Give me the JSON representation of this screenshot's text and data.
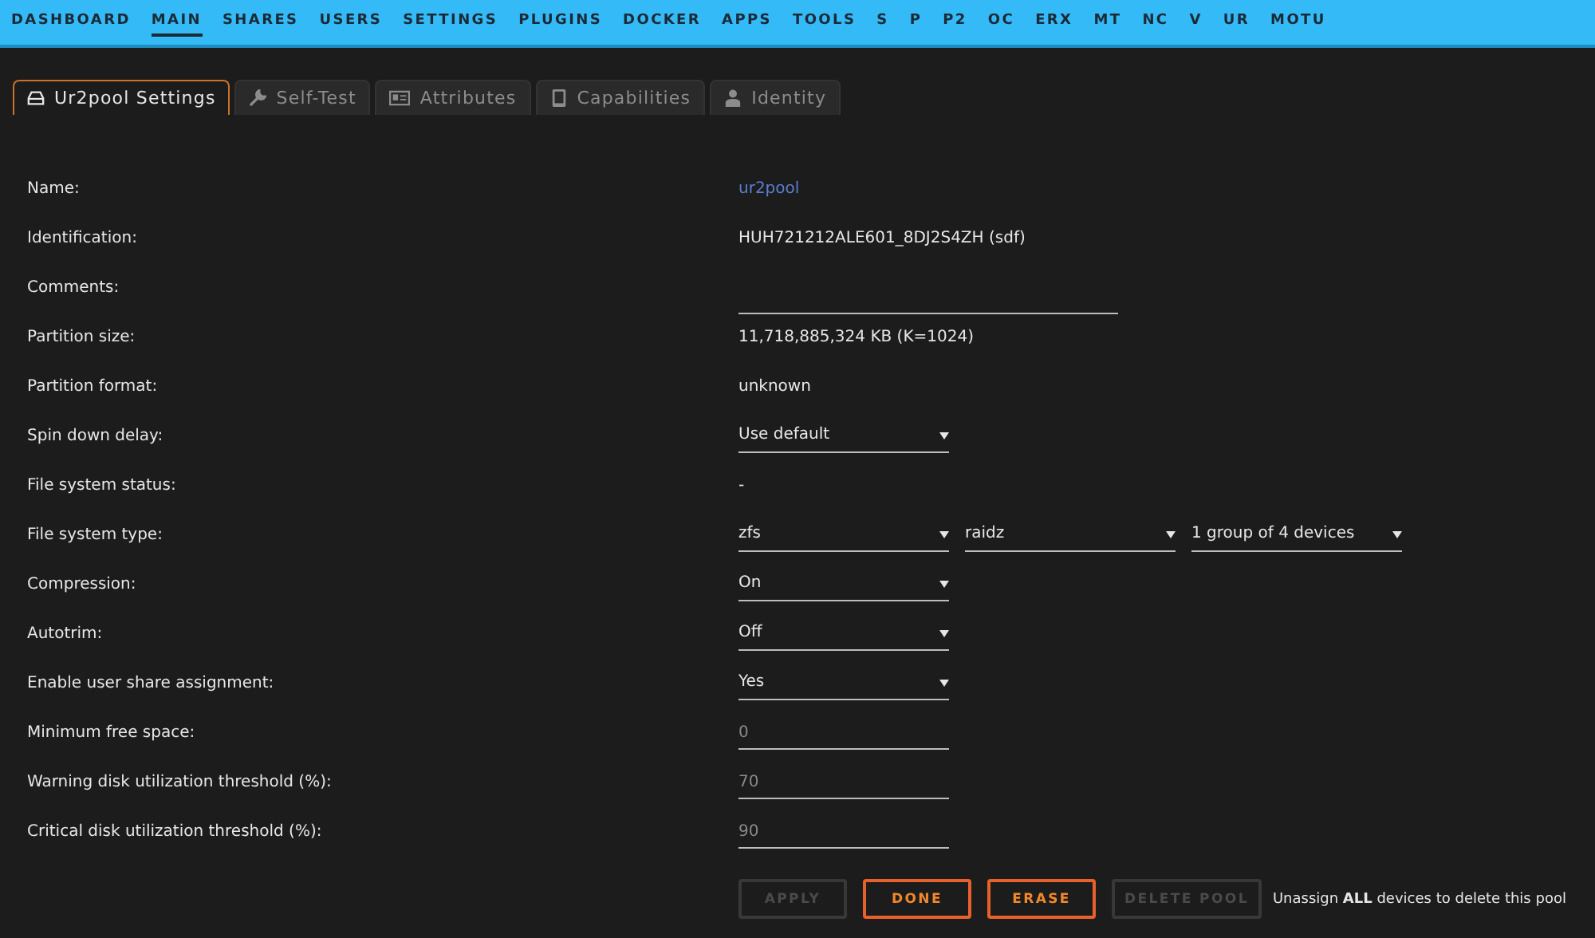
{
  "nav": [
    {
      "label": "DASHBOARD",
      "selected": false
    },
    {
      "label": "MAIN",
      "selected": true
    },
    {
      "label": "SHARES",
      "selected": false
    },
    {
      "label": "USERS",
      "selected": false
    },
    {
      "label": "SETTINGS",
      "selected": false
    },
    {
      "label": "PLUGINS",
      "selected": false
    },
    {
      "label": "DOCKER",
      "selected": false
    },
    {
      "label": "APPS",
      "selected": false
    },
    {
      "label": "TOOLS",
      "selected": false
    },
    {
      "label": "S",
      "selected": false
    },
    {
      "label": "P",
      "selected": false
    },
    {
      "label": "P2",
      "selected": false
    },
    {
      "label": "OC",
      "selected": false
    },
    {
      "label": "ERX",
      "selected": false
    },
    {
      "label": "MT",
      "selected": false
    },
    {
      "label": "NC",
      "selected": false
    },
    {
      "label": "V",
      "selected": false
    },
    {
      "label": "UR",
      "selected": false
    },
    {
      "label": "MOTU",
      "selected": false
    }
  ],
  "tabs": [
    {
      "label": "Ur2pool Settings",
      "kind": "drive",
      "selected": true
    },
    {
      "label": "Self-Test",
      "kind": "wrench",
      "selected": false
    },
    {
      "label": "Attributes",
      "kind": "card",
      "selected": false
    },
    {
      "label": "Capabilities",
      "kind": "tablet",
      "selected": false
    },
    {
      "label": "Identity",
      "kind": "user",
      "selected": false
    }
  ],
  "fields": [
    {
      "label": "Name:",
      "kind": "link",
      "value": "ur2pool"
    },
    {
      "label": "Identification:",
      "kind": "text",
      "value": "HUH721212ALE601_8DJ2S4ZH (sdf)"
    },
    {
      "label": "Comments:",
      "kind": "input"
    },
    {
      "label": "Partition size:",
      "kind": "text",
      "value": "11,718,885,324 KB (K=1024)"
    },
    {
      "label": "Partition format:",
      "kind": "text",
      "value": "unknown"
    },
    {
      "label": "Spin down delay:",
      "kind": "select",
      "options": [
        "Use default"
      ]
    },
    {
      "label": "File system status:",
      "kind": "text",
      "value": "-"
    },
    {
      "label": "File system type:",
      "kind": "select",
      "options": [
        "zfs",
        "raidz",
        "1 group of 4 devices"
      ]
    },
    {
      "label": "Compression:",
      "kind": "select",
      "options": [
        "On"
      ]
    },
    {
      "label": "Autotrim:",
      "kind": "select",
      "options": [
        "Off"
      ]
    },
    {
      "label": "Enable user share assignment:",
      "kind": "select",
      "options": [
        "Yes"
      ]
    },
    {
      "label": "Minimum free space:",
      "kind": "input",
      "placeholder": "0"
    },
    {
      "label": "Warning disk utilization threshold (%):",
      "kind": "input",
      "placeholder": "70"
    },
    {
      "label": "Critical disk utilization threshold (%):",
      "kind": "input",
      "placeholder": "90"
    }
  ],
  "buttons": [
    {
      "label": "APPLY",
      "disabled": true
    },
    {
      "label": "DONE",
      "disabled": false
    },
    {
      "label": "ERASE",
      "disabled": false
    },
    {
      "label": "DELETE POOL",
      "disabled": true
    }
  ],
  "note": "Unassign **ALL** devices to delete this pool"
}
